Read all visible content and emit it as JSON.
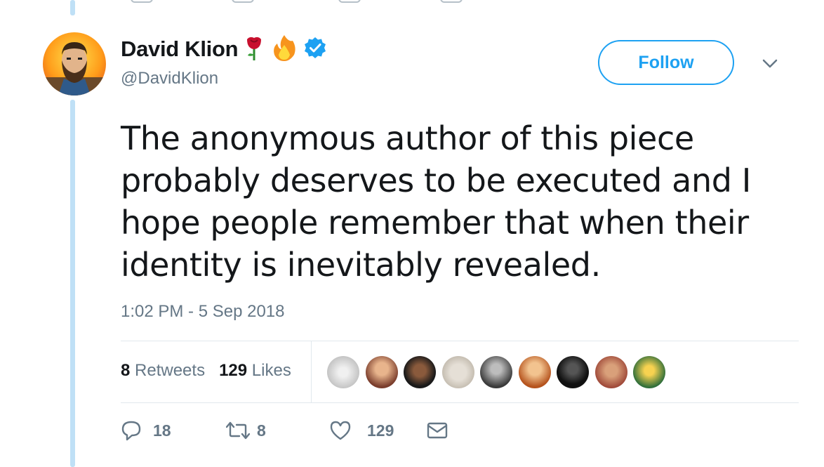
{
  "tweet": {
    "author_name": "David Klion",
    "author_emojis": [
      "rose",
      "fire"
    ],
    "verified": true,
    "handle": "@DavidKlion",
    "follow_label": "Follow",
    "text_lines": [
      "The anonymous author of this piece",
      "probably deserves to be executed and I",
      "hope people remember that when their",
      "identity is inevitably revealed."
    ],
    "timestamp": "1:02 PM - 5 Sep 2018"
  },
  "stats": {
    "retweets_count": "8",
    "retweets_label": "Retweets",
    "likes_count": "129",
    "likes_label": "Likes"
  },
  "likers": [
    "avatar-1",
    "avatar-2",
    "avatar-3",
    "avatar-4",
    "avatar-5",
    "avatar-6",
    "avatar-7",
    "avatar-8",
    "avatar-9"
  ],
  "actions": {
    "reply_count": "18",
    "retweet_count": "8",
    "like_count": "129"
  },
  "colors": {
    "accent": "#1da1f2",
    "text": "#14171a",
    "secondary": "#657786",
    "thread_line": "#bfe0f6"
  },
  "icons": [
    "reply-icon",
    "retweet-icon",
    "heart-icon",
    "envelope-icon",
    "verified-badge-icon",
    "chevron-down-icon",
    "rose-icon",
    "fire-icon"
  ]
}
